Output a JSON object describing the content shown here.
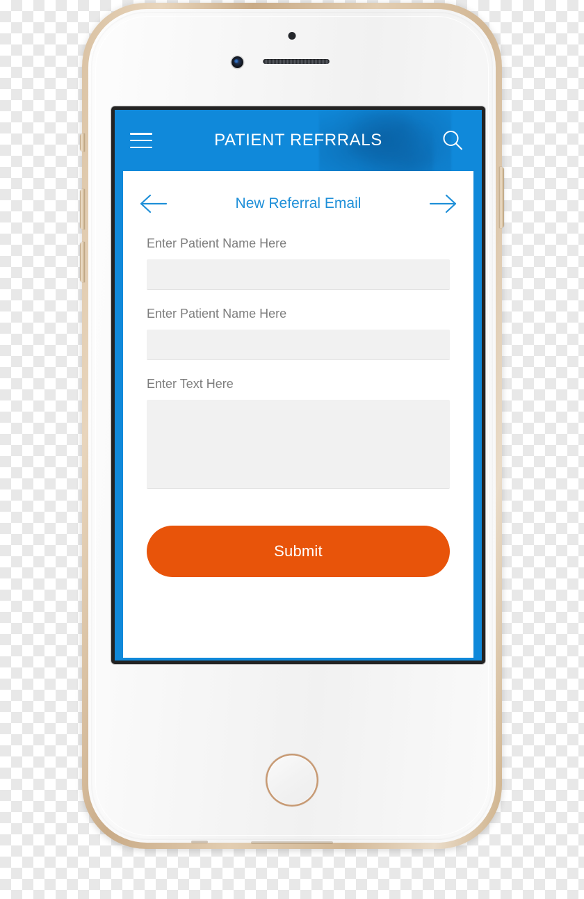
{
  "device": {
    "name": "smartphone-mockup",
    "finish": "gold-white",
    "hardware": {
      "proximity_sensor": "proximity-sensor",
      "earpiece_speaker": "earpiece-speaker",
      "front_camera": "front-camera",
      "home_button": "home-button",
      "mute_switch": "mute-switch",
      "volume_up": "volume-up-button",
      "volume_down": "volume-down-button",
      "power_button": "power-button"
    }
  },
  "app": {
    "header": {
      "title": "PATIENT REFRRALS",
      "menu_icon": "hamburger-menu-icon",
      "search_icon": "search-icon",
      "background_color": "#1089da",
      "text_color": "#ffffff"
    },
    "nav": {
      "title": "New Referral Email",
      "back_icon": "arrow-left-icon",
      "forward_icon": "arrow-right-icon",
      "title_color": "#1e8fd8"
    },
    "form": {
      "fields": [
        {
          "label": "Enter Patient Name Here",
          "value": "",
          "placeholder": "",
          "type": "text"
        },
        {
          "label": "Enter Patient Name Here",
          "value": "",
          "placeholder": "",
          "type": "text"
        },
        {
          "label": "Enter Text Here",
          "value": "",
          "placeholder": "",
          "type": "textarea"
        }
      ]
    },
    "submit": {
      "label": "Submit",
      "color": "#e8540a",
      "text_color": "#ffffff"
    }
  }
}
